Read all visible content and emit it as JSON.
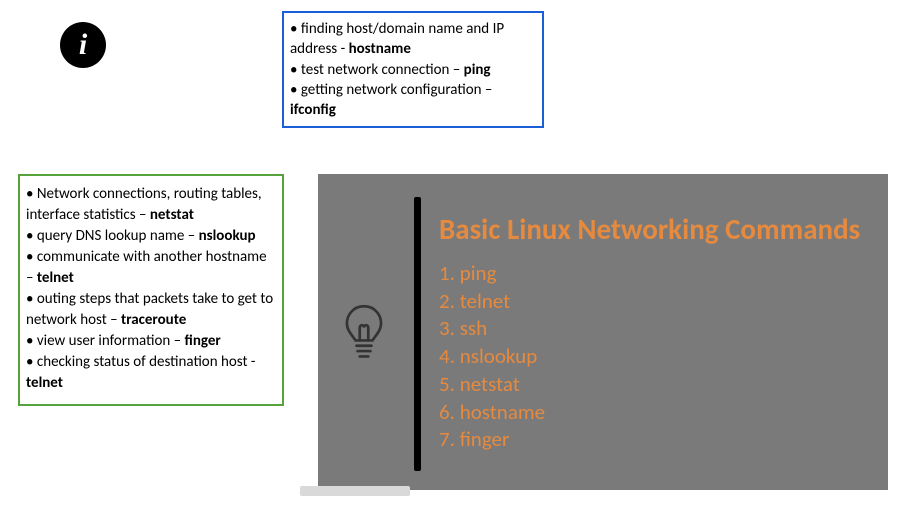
{
  "info_symbol": "i",
  "blue_box": {
    "items": [
      {
        "text": "finding host/domain name and IP address - ",
        "cmd": "hostname"
      },
      {
        "text": "test network connection – ",
        "cmd": "ping"
      },
      {
        "text": "getting network configuration – ",
        "cmd": "ifconfig"
      }
    ]
  },
  "green_box": {
    "items": [
      {
        "text": "Network connections, routing tables, interface statistics – ",
        "cmd": "netstat"
      },
      {
        "text": "query DNS lookup name – ",
        "cmd": "nslookup"
      },
      {
        "text": "communicate with another hostname – ",
        "cmd": "telnet"
      },
      {
        "text": "outing steps that packets take to get to network host – ",
        "cmd": "traceroute"
      },
      {
        "text": "view user information – ",
        "cmd": "finger"
      },
      {
        "text": "checking status of destination host - ",
        "cmd": "telnet"
      }
    ]
  },
  "slate": {
    "title": "Basic Linux Networking Commands",
    "commands": [
      "1. ping",
      "2. telnet",
      "3. ssh",
      "4. nslookup",
      "5. netstat",
      "6. hostname",
      "7. finger"
    ]
  }
}
